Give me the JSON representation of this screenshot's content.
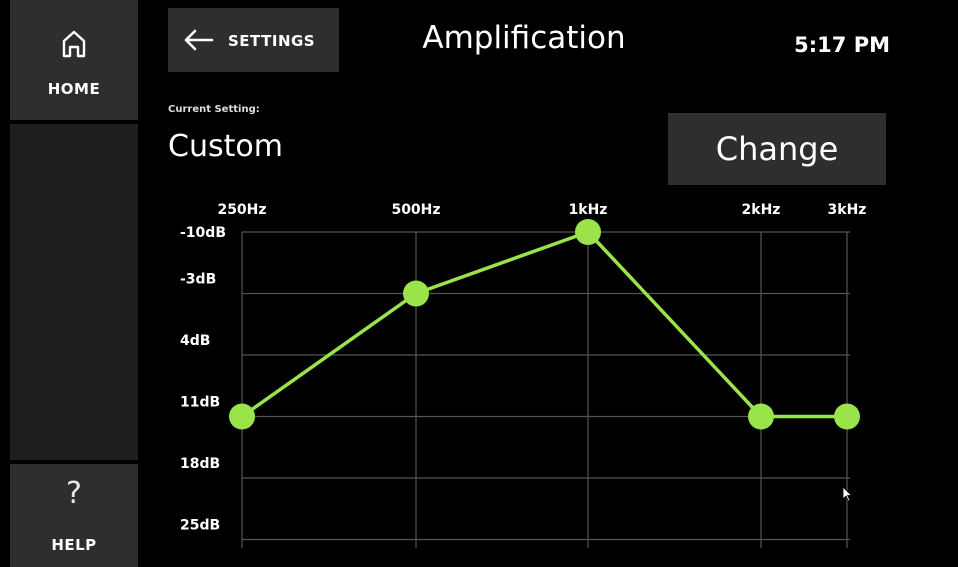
{
  "sidebar": {
    "home_label": "HOME",
    "help_label": "HELP",
    "help_glyph": "?"
  },
  "header": {
    "back_label": "SETTINGS",
    "title": "Amplification",
    "time": "5:17 PM"
  },
  "setting": {
    "current_label": "Current Setting:",
    "current_value": "Custom",
    "change_label": "Change"
  },
  "chart_data": {
    "type": "line",
    "x": [
      "250Hz",
      "500Hz",
      "1kHz",
      "2kHz",
      "3kHz"
    ],
    "y_ticks": [
      "-10dB",
      "-3dB",
      "4dB",
      "11dB",
      "18dB",
      "25dB"
    ],
    "y_values": [
      -10,
      -3,
      4,
      11,
      18,
      25
    ],
    "values": [
      11,
      -3,
      -10,
      11,
      11
    ],
    "ylim": [
      -10,
      25
    ],
    "y_inverted": true,
    "grid": true,
    "line_color": "#9be34a"
  },
  "colors": {
    "button_bg": "#2e2e2e",
    "accent": "#9be34a"
  }
}
